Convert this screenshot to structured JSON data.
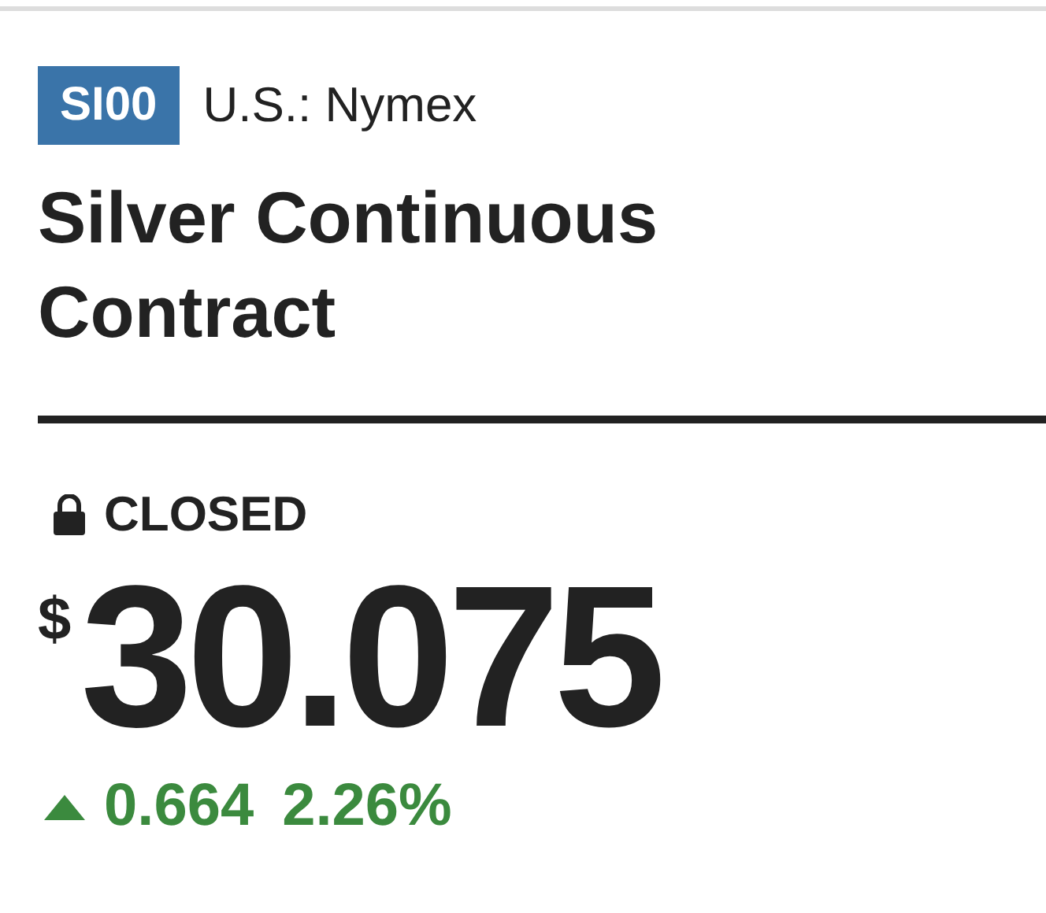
{
  "ticker": {
    "symbol": "SI00",
    "exchange": "U.S.: Nymex"
  },
  "title": "Silver Continuous Contract",
  "status": {
    "label": "CLOSED"
  },
  "price": {
    "currency": "$",
    "value": "30.075"
  },
  "change": {
    "rising": true,
    "amount": "0.664",
    "percent": "2.26%"
  }
}
